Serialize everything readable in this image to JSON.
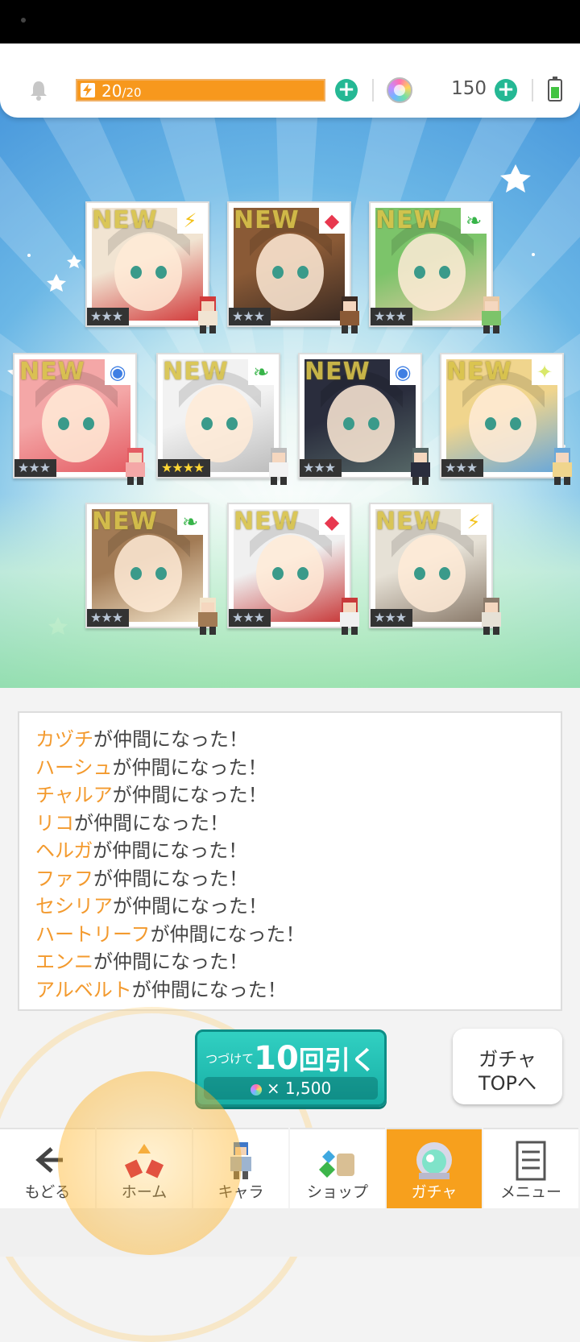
{
  "topbar": {
    "energy_current": "20",
    "energy_max": "/20",
    "energy_fraction": 1.0,
    "gem_count": "150",
    "icons": {
      "bell": "bell-icon",
      "energy": "lightning-icon",
      "gem": "rainbow-gem-icon",
      "battery": "battery-icon",
      "plus": "plus-icon"
    }
  },
  "results": {
    "new_label": "NEW",
    "cards": [
      {
        "name": "カヅチ",
        "stars": "★★★",
        "attribute": "lightning",
        "attr_glyph": "⚡",
        "attr_color": "#f3c21b",
        "is_new": true
      },
      {
        "name": "ハーシュ",
        "stars": "★★★",
        "attribute": "fire",
        "attr_glyph": "◆",
        "attr_color": "#e8384f",
        "is_new": true
      },
      {
        "name": "チャルア",
        "stars": "★★★",
        "attribute": "leaf",
        "attr_glyph": "❧",
        "attr_color": "#37b449",
        "is_new": true
      },
      {
        "name": "リコ",
        "stars": "★★★",
        "attribute": "water",
        "attr_glyph": "◉",
        "attr_color": "#3f7fe3",
        "is_new": true
      },
      {
        "name": "ヘルガ",
        "stars": "★★★★",
        "attribute": "leaf",
        "attr_glyph": "❧",
        "attr_color": "#37b449",
        "is_new": true
      },
      {
        "name": "ファフ",
        "stars": "★★★",
        "attribute": "water",
        "attr_glyph": "◉",
        "attr_color": "#3f7fe3",
        "is_new": true
      },
      {
        "name": "セシリア",
        "stars": "★★★",
        "attribute": "light",
        "attr_glyph": "✦",
        "attr_color": "#d9e86a",
        "is_new": true
      },
      {
        "name": "ハートリーフ",
        "stars": "★★★",
        "attribute": "leaf",
        "attr_glyph": "❧",
        "attr_color": "#37b449",
        "is_new": true
      },
      {
        "name": "エンニ",
        "stars": "★★★",
        "attribute": "fire",
        "attr_glyph": "◆",
        "attr_color": "#e8384f",
        "is_new": true
      },
      {
        "name": "アルベルト",
        "stars": "★★★",
        "attribute": "lightning",
        "attr_glyph": "⚡",
        "attr_color": "#f3c21b",
        "is_new": true
      }
    ]
  },
  "log": {
    "suffix": "が仲間になった！",
    "names": [
      "カヅチ",
      "ハーシュ",
      "チャルア",
      "リコ",
      "ヘルガ",
      "ファフ",
      "セシリア",
      "ハートリーフ",
      "エンニ",
      "アルベルト"
    ]
  },
  "pull_button": {
    "prefix": "つづけて",
    "count": "10",
    "suffix": "回引く",
    "cost": "× 1,500"
  },
  "gacha_top_button": {
    "line1": "ガチャ",
    "line2": "TOPへ"
  },
  "nav": [
    {
      "label": "もどる",
      "icon": "back-arrow-icon",
      "active": false
    },
    {
      "label": "ホーム",
      "icon": "home-icon",
      "active": false
    },
    {
      "label": "キャラ",
      "icon": "character-icon",
      "active": false
    },
    {
      "label": "ショップ",
      "icon": "shop-icon",
      "active": false
    },
    {
      "label": "ガチャ",
      "icon": "gacha-icon",
      "active": true
    },
    {
      "label": "メニュー",
      "icon": "menu-icon",
      "active": false
    }
  ],
  "colors": {
    "accent": "#f7981d",
    "teal": "#25b894",
    "name_highlight": "#f39a2e",
    "nav_active": "#f7a01d"
  }
}
